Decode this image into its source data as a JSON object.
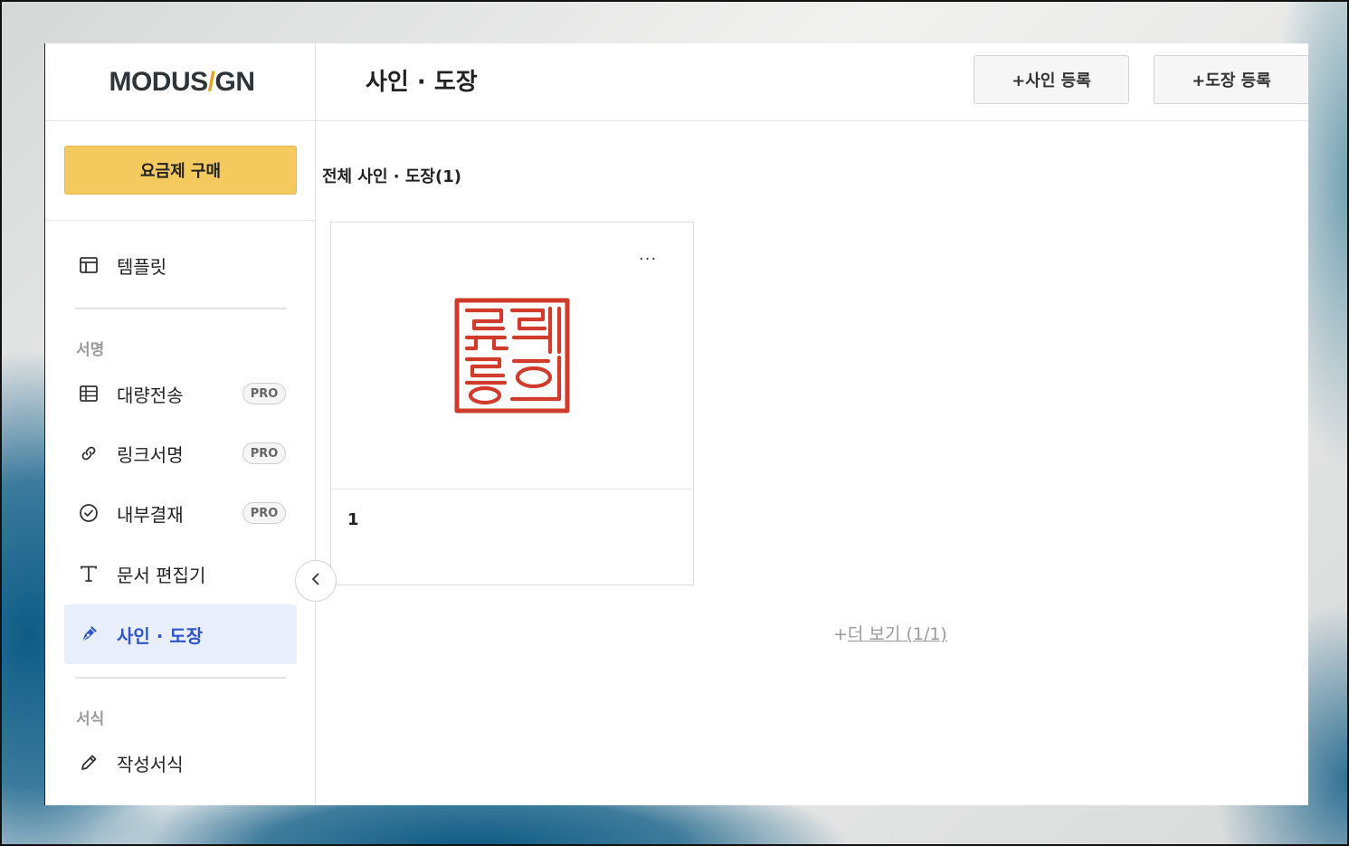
{
  "brand": {
    "logo_part1": "MODUS",
    "logo_slash": "/",
    "logo_part2": "GN"
  },
  "sidebar": {
    "plan_button": "요금제 구매",
    "template_label": "템플릿",
    "sign_section": "서명",
    "items": [
      {
        "label": "대량전송",
        "badge": "PRO",
        "icon": "table-icon"
      },
      {
        "label": "링크서명",
        "badge": "PRO",
        "icon": "link-icon"
      },
      {
        "label": "내부결재",
        "badge": "PRO",
        "icon": "check-circle-icon"
      },
      {
        "label": "문서 편집기",
        "icon": "text-icon"
      },
      {
        "label": "사인 · 도장",
        "icon": "pen-nib-icon",
        "active": true
      }
    ],
    "form_section": "서식",
    "form_item": "작성서식"
  },
  "header": {
    "title": "사인 · 도장",
    "add_sign": "+사인 등록",
    "add_stamp": "+도장 등록"
  },
  "main": {
    "section_title": "전체 사인 · 도장(1)",
    "cards": [
      {
        "name": "1",
        "menu": "···",
        "image": "red-seal-stamp"
      }
    ],
    "more_prefix": "+",
    "more_text": "더 보기 (1/1)"
  },
  "colors": {
    "accent": "#2f55c9",
    "plan": "#f4c95d",
    "seal": "#d13b2c",
    "logo_slash": "#e0a923"
  }
}
